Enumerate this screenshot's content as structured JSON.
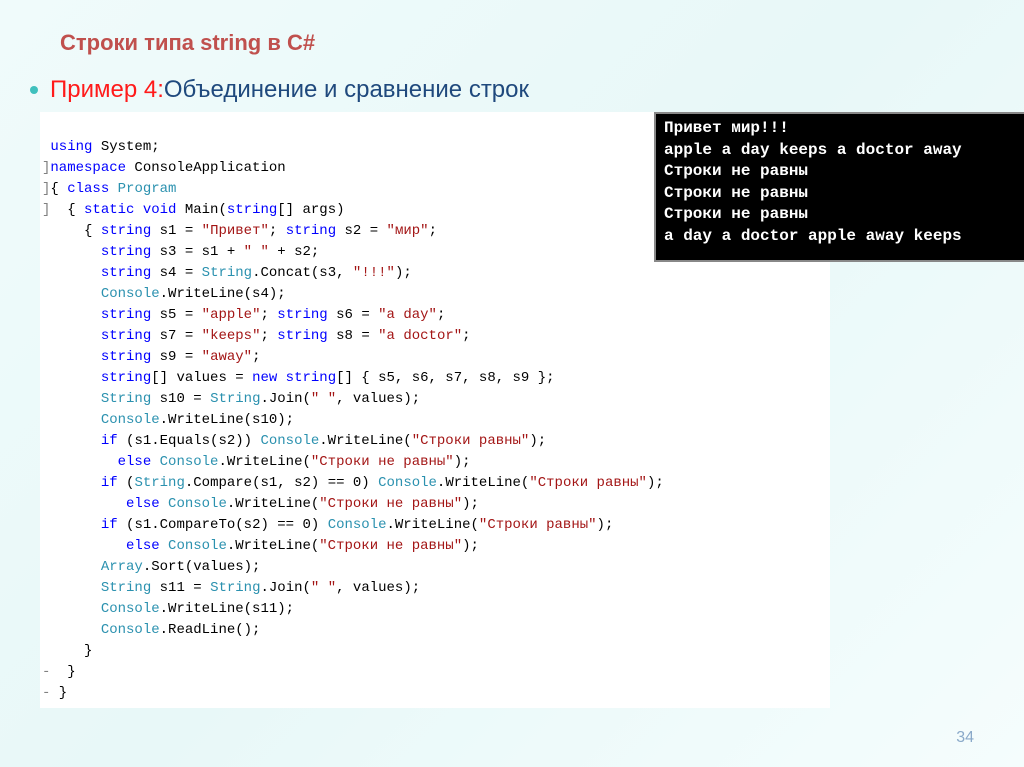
{
  "title": "Строки типа string в C#",
  "example_label": "Пример 4:",
  "subtitle": " Объединение и сравнение строк",
  "code": {
    "l1": "using",
    "l1b": " System;",
    "l2a": "namespace",
    "l2b": " ConsoleApplication",
    "l3a": "{ ",
    "l3b": "class",
    "l3c": " ",
    "l3d": "Program",
    "l4a": "  { ",
    "l4b": "static void",
    "l4c": " Main(",
    "l4d": "string",
    "l4e": "[] args)",
    "l5a": "    { ",
    "l5b": "string",
    "l5c": " s1 = ",
    "l5d": "\"Привет\"",
    "l5e": "; ",
    "l5f": "string",
    "l5g": " s2 = ",
    "l5h": "\"мир\"",
    "l5i": ";",
    "l6a": "      ",
    "l6b": "string",
    "l6c": " s3 = s1 + ",
    "l6d": "\" \"",
    "l6e": " + s2;",
    "l7a": "      ",
    "l7b": "string",
    "l7c": " s4 = ",
    "l7d": "String",
    "l7e": ".Concat(s3, ",
    "l7f": "\"!!!\"",
    "l7g": ");",
    "l8a": "      ",
    "l8b": "Console",
    "l8c": ".WriteLine(s4);",
    "l9a": "      ",
    "l9b": "string",
    "l9c": " s5 = ",
    "l9d": "\"apple\"",
    "l9e": "; ",
    "l9f": "string",
    "l9g": " s6 = ",
    "l9h": "\"a day\"",
    "l9i": ";",
    "l10a": "      ",
    "l10b": "string",
    "l10c": " s7 = ",
    "l10d": "\"keeps\"",
    "l10e": "; ",
    "l10f": "string",
    "l10g": " s8 = ",
    "l10h": "\"a doctor\"",
    "l10i": ";",
    "l11a": "      ",
    "l11b": "string",
    "l11c": " s9 = ",
    "l11d": "\"away\"",
    "l11e": ";",
    "l12a": "      ",
    "l12b": "string",
    "l12c": "[] values = ",
    "l12d": "new string",
    "l12e": "[] { s5, s6, s7, s8, s9 };",
    "l13a": "      ",
    "l13b": "String",
    "l13c": " s10 = ",
    "l13d": "String",
    "l13e": ".Join(",
    "l13f": "\" \"",
    "l13g": ", values);",
    "l14a": "      ",
    "l14b": "Console",
    "l14c": ".WriteLine(s10);",
    "l15a": "      ",
    "l15b": "if",
    "l15c": " (s1.Equals(s2)) ",
    "l15d": "Console",
    "l15e": ".WriteLine(",
    "l15f": "\"Строки равны\"",
    "l15g": ");",
    "l16a": "        ",
    "l16b": "else",
    "l16c": " ",
    "l16d": "Console",
    "l16e": ".WriteLine(",
    "l16f": "\"Строки не равны\"",
    "l16g": ");",
    "l17a": "      ",
    "l17b": "if",
    "l17c": " (",
    "l17d": "String",
    "l17e": ".Compare(s1, s2) == 0) ",
    "l17f": "Console",
    "l17g": ".WriteLine(",
    "l17h": "\"Строки равны\"",
    "l17i": ");",
    "l18a": "         ",
    "l18b": "else",
    "l18c": " ",
    "l18d": "Console",
    "l18e": ".WriteLine(",
    "l18f": "\"Строки не равны\"",
    "l18g": ");",
    "l19a": "      ",
    "l19b": "if",
    "l19c": " (s1.CompareTo(s2) == 0) ",
    "l19d": "Console",
    "l19e": ".WriteLine(",
    "l19f": "\"Строки равны\"",
    "l19g": ");",
    "l20a": "         ",
    "l20b": "else",
    "l20c": " ",
    "l20d": "Console",
    "l20e": ".WriteLine(",
    "l20f": "\"Строки не равны\"",
    "l20g": ");",
    "l21a": "      ",
    "l21b": "Array",
    "l21c": ".Sort(values);",
    "l22a": "      ",
    "l22b": "String",
    "l22c": " s11 = ",
    "l22d": "String",
    "l22e": ".Join(",
    "l22f": "\" \"",
    "l22g": ", values);",
    "l23a": "      ",
    "l23b": "Console",
    "l23c": ".WriteLine(s11);",
    "l24a": "      ",
    "l24b": "Console",
    "l24c": ".ReadLine();",
    "l25": "    }",
    "l26": "  }",
    "l27": " }"
  },
  "console": {
    "o1": "Привет мир!!!",
    "o2": "apple a day keeps a doctor away",
    "o3": "Строки не равны",
    "o4": "Строки не равны",
    "o5": "Строки не равны",
    "o6": "a day a doctor apple away keeps"
  },
  "page_number": "34"
}
